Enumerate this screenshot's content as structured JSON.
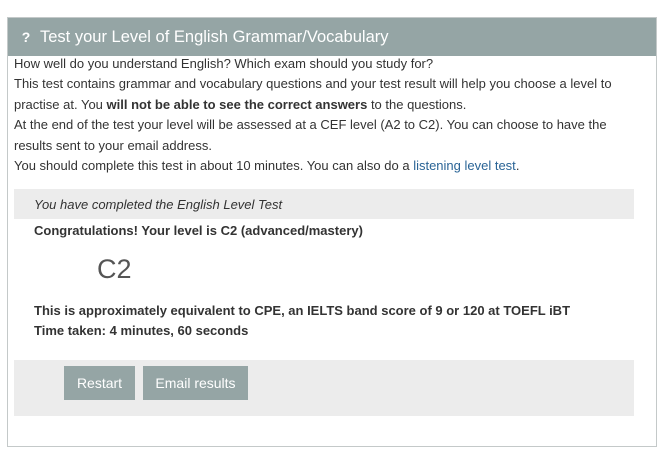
{
  "header": {
    "icon": "question-icon",
    "icon_glyph": "?",
    "title": "Test your Level of English Grammar/Vocabulary"
  },
  "intro": {
    "line1": "How well do you understand English? Which exam should you study for?",
    "line2a": "This test contains grammar and vocabulary questions and your test result will help you choose a level to practise at. You ",
    "line2b": "will not be able to see the correct answers",
    "line2c": " to the questions.",
    "line3": "At the end of the test your level will be assessed at a CEF level (A2 to C2). You can choose to have the results sent to your email address.",
    "line4a": "You should complete this test in about 10 minutes. You can also do a ",
    "line4_link": "listening level test",
    "line4b": "."
  },
  "result": {
    "completed_text": "You have completed the English Level Test",
    "congrats_text": "Congratulations! Your level is C2 (advanced/mastery)",
    "level": "C2",
    "equivalent_text": "This is approximately equivalent to CPE, an IELTS band score of 9 or 120 at TOEFL iBT",
    "time_taken": "Time taken: 4 minutes, 60 seconds"
  },
  "buttons": {
    "restart": "Restart",
    "email": "Email results"
  },
  "colors": {
    "header_bg": "#95a5a5",
    "button_bg": "#95a5a5",
    "link": "#2a6496",
    "bar_bg": "#ececec"
  }
}
